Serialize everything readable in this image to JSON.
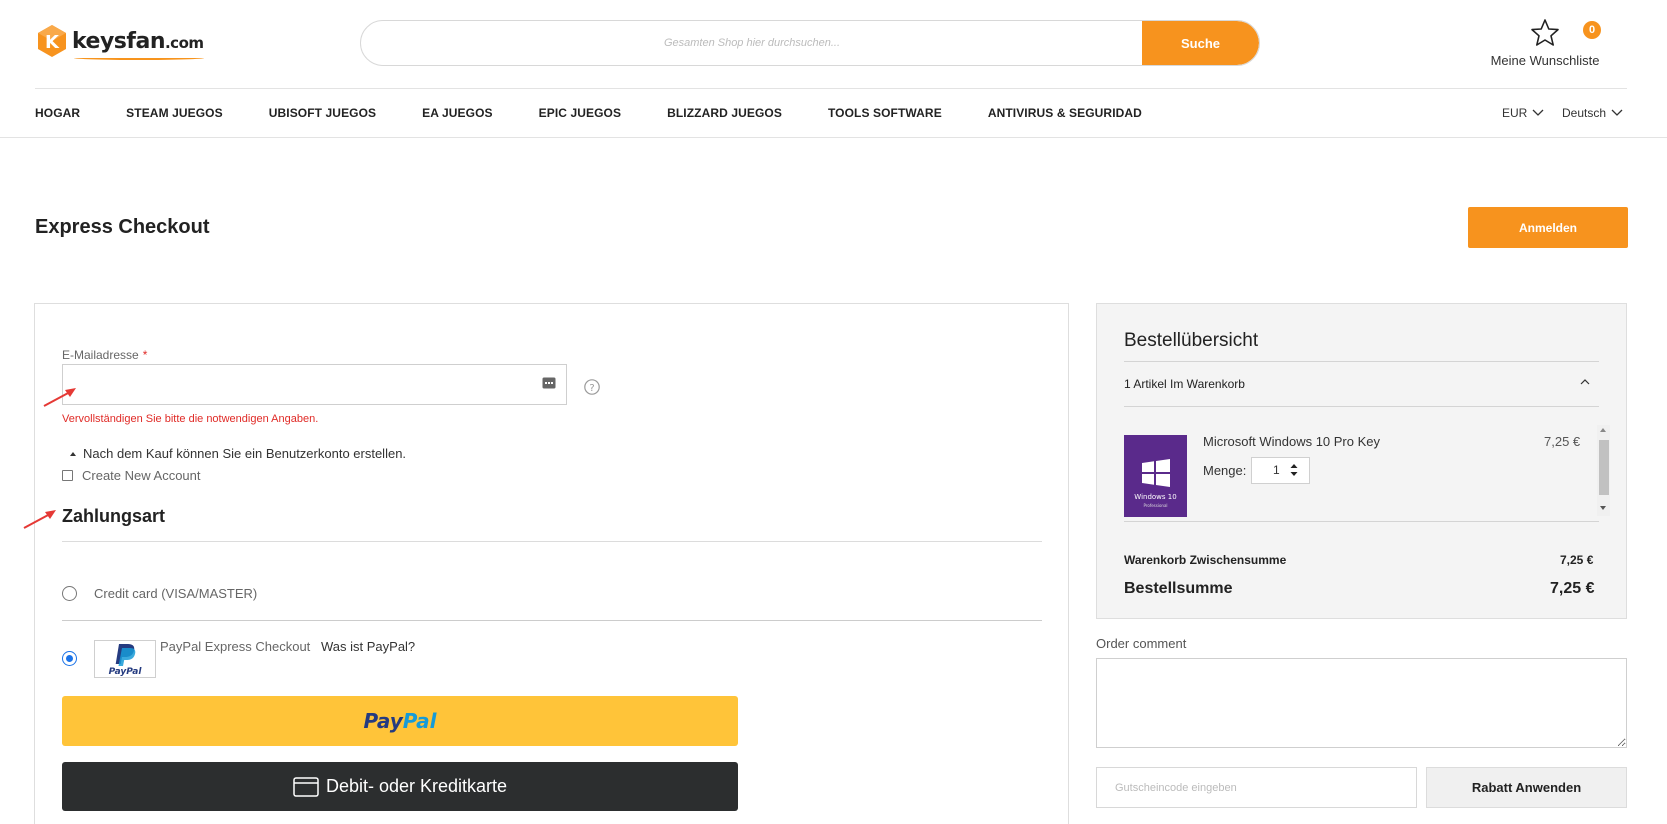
{
  "header": {
    "logo_text": "keysfan",
    "logo_domain": ".com",
    "search_placeholder": "Gesamten Shop hier durchsuchen...",
    "search_button": "Suche",
    "wishlist_count": "0",
    "wishlist_label": "Meine Wunschliste"
  },
  "nav": {
    "items": [
      "HOGAR",
      "STEAM JUEGOS",
      "UBISOFT JUEGOS",
      "EA JUEGOS",
      "EPIC JUEGOS",
      "BLIZZARD JUEGOS",
      "TOOLS SOFTWARE",
      "ANTIVIRUS & SEGURIDAD"
    ],
    "currency": "EUR",
    "language": "Deutsch"
  },
  "page": {
    "title": "Express Checkout",
    "login_button": "Anmelden"
  },
  "form": {
    "email_label": "E-Mailadresse",
    "required_mark": "*",
    "email_value": "",
    "error_message": "Vervollständigen Sie bitte die notwendigen Angaben.",
    "account_note": "Nach dem Kauf können Sie ein Benutzerkonto erstellen.",
    "create_account_label": "Create New Account",
    "create_account_checked": false
  },
  "payment": {
    "title": "Zahlungsart",
    "options": [
      {
        "label": "Credit card (VISA/MASTER)",
        "selected": false
      },
      {
        "label": "PayPal Express Checkout",
        "selected": true,
        "link": "Was ist PayPal?",
        "logo_text": "PayPal"
      }
    ],
    "paypal_button_1": "Pay",
    "paypal_button_2": "Pal",
    "card_button": "Debit- oder Kreditkarte"
  },
  "summary": {
    "title": "Bestellübersicht",
    "cart_count": "1 Artikel Im Warenkorb",
    "product": {
      "name": "Microsoft Windows 10 Pro Key",
      "price": "7,25 €",
      "qty_label": "Menge:",
      "qty": "1",
      "image_caption": "Windows 10",
      "image_caption_2": "Professional"
    },
    "subtotal_label": "Warenkorb Zwischensumme",
    "subtotal_value": "7,25 €",
    "total_label": "Bestellsumme",
    "total_value": "7,25 €"
  },
  "comment": {
    "label": "Order comment",
    "value": ""
  },
  "coupon": {
    "placeholder": "Gutscheincode eingeben",
    "button": "Rabatt Anwenden"
  },
  "colors": {
    "accent": "#f7931e",
    "error": "#e02b27",
    "paypal_yellow": "#ffc439",
    "card_dark": "#2c2e2f",
    "product_purple": "#5a2a8b"
  }
}
